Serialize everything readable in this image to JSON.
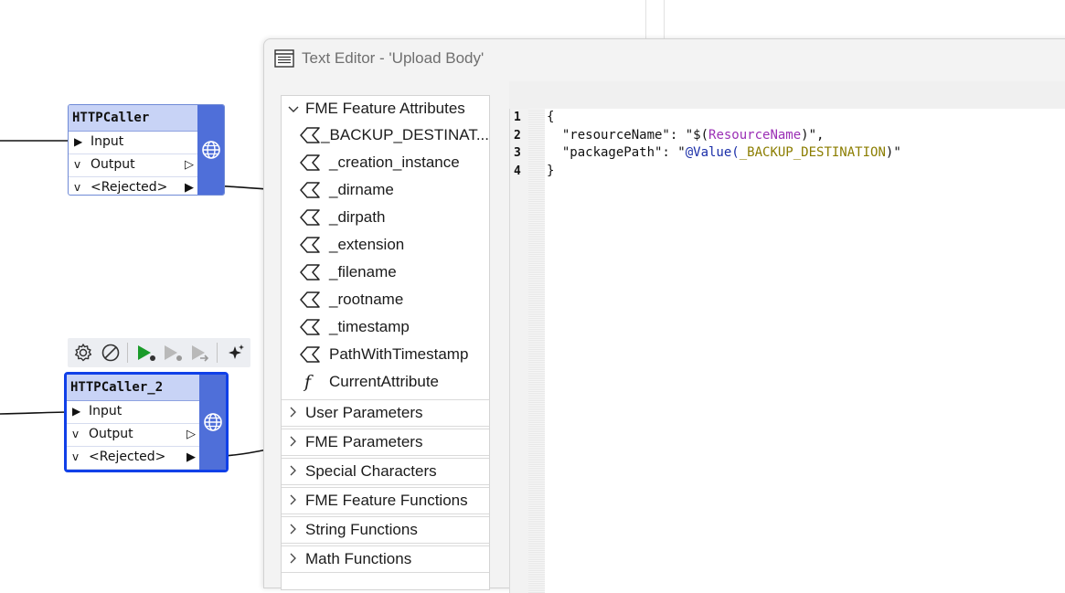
{
  "canvas": {
    "nodes": [
      {
        "title": "HTTPCaller",
        "ports": [
          {
            "label": "Input",
            "mark": "▶",
            "port": ""
          },
          {
            "label": "Output",
            "mark": "v",
            "port": "▷"
          },
          {
            "label": "<Rejected>",
            "mark": "v",
            "port": "▶"
          }
        ]
      },
      {
        "title": "HTTPCaller_2",
        "ports": [
          {
            "label": "Input",
            "mark": "▶",
            "port": ""
          },
          {
            "label": "Output",
            "mark": "v",
            "port": "▷"
          },
          {
            "label": "<Rejected>",
            "mark": "v",
            "port": "▶"
          }
        ]
      }
    ],
    "toolbar_icons": [
      "gear-icon",
      "disable-icon",
      "run-to-this-icon",
      "run-from-this-icon",
      "run-partial-icon",
      "magic-icon"
    ],
    "colors": {
      "node_header": "#c8d3f6",
      "node_side": "#4f6fd9",
      "selected_border": "#1040e8",
      "run_green": "#1a9b2a"
    }
  },
  "dialog": {
    "title": "Text Editor - 'Upload Body'",
    "tree": {
      "open_group": "FME Feature Attributes",
      "attributes": [
        "_BACKUP_DESTINAT...",
        "_creation_instance",
        "_dirname",
        "_dirpath",
        "_extension",
        "_filename",
        "_rootname",
        "_timestamp",
        "PathWithTimestamp"
      ],
      "function_item": "CurrentAttribute",
      "groups": [
        "User Parameters",
        "FME Parameters",
        "Special Characters",
        "FME Feature Functions",
        "String Functions",
        "Math Functions"
      ]
    },
    "editor": {
      "line_numbers": [
        "1",
        "2",
        "3",
        "4"
      ],
      "line1": "{",
      "line2_prefix": "  \"resourceName\": \"$(",
      "line2_param": "ResourceName",
      "line2_suffix": ")\",",
      "line3_prefix": "  \"packagePath\": \"",
      "line3_func": "@Value(",
      "line3_attr": "_BACKUP_DESTINATION",
      "line3_suffix": ")\"",
      "line4": "}"
    }
  }
}
